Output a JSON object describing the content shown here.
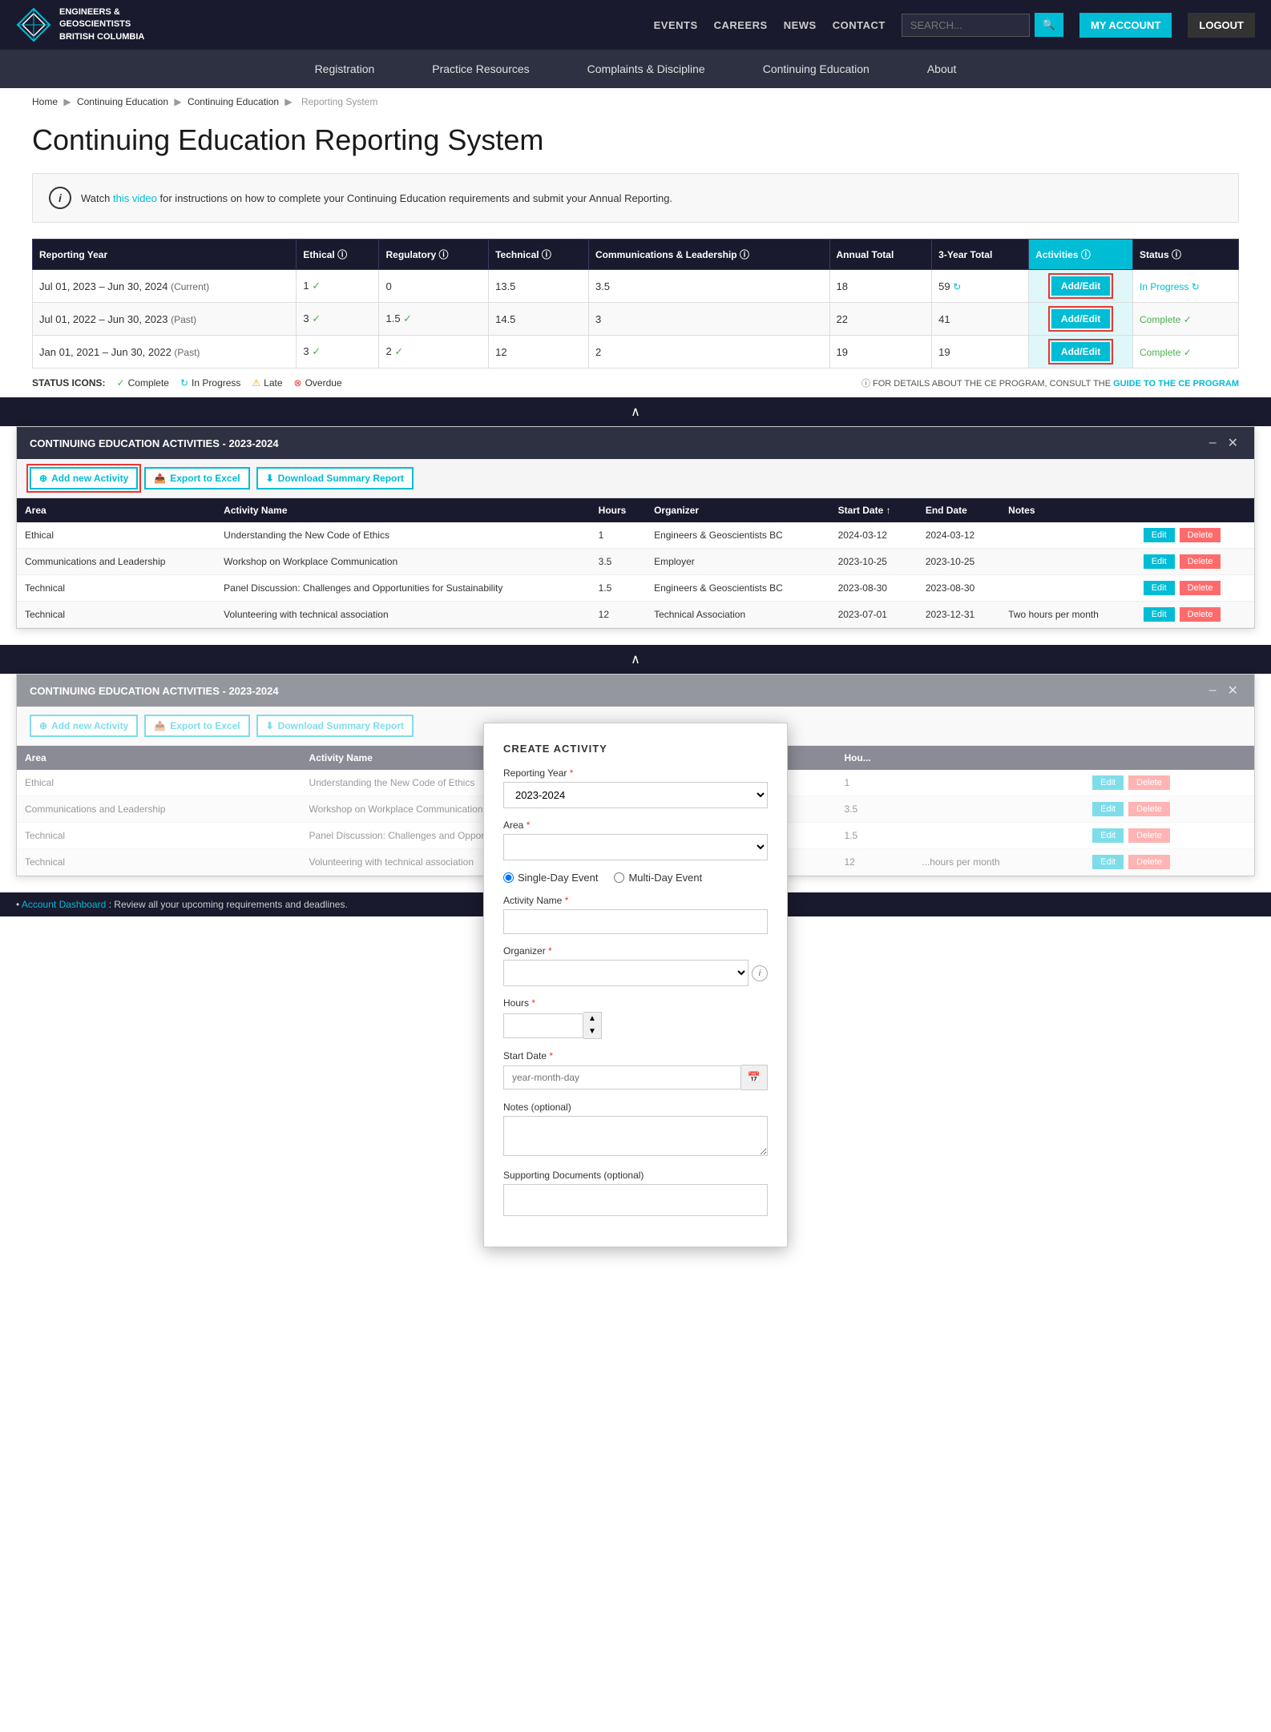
{
  "topNav": {
    "logoLine1": "ENGINEERS &",
    "logoLine2": "GEOSCIENTISTS",
    "logoLine3": "BRITISH COLUMBIA",
    "links": [
      "EVENTS",
      "CAREERS",
      "NEWS",
      "CONTACT"
    ],
    "searchPlaceholder": "SEARCH...",
    "myAccountLabel": "MY ACCOUNT",
    "logoutLabel": "LOGOUT"
  },
  "secNav": {
    "items": [
      "Registration",
      "Practice Resources",
      "Complaints & Discipline",
      "Continuing Education",
      "About"
    ]
  },
  "breadcrumb": {
    "items": [
      "Home",
      "Continuing Education",
      "Continuing Education",
      "Reporting System"
    ]
  },
  "pageTitle": "Continuing Education Reporting System",
  "infoBox": {
    "text1": "Watch ",
    "linkText": "this video",
    "text2": " for instructions on how to complete your Continuing Education requirements and submit your Annual Reporting."
  },
  "reportTable": {
    "headers": [
      "Reporting Year",
      "Ethical ⓘ",
      "Regulatory ⓘ",
      "Technical ⓘ",
      "Communications & Leadership ⓘ",
      "Annual Total",
      "3-Year Total",
      "Activities ⓘ",
      "Status ⓘ"
    ],
    "rows": [
      {
        "year": "Jul 01, 2023 – Jun 30, 2024",
        "yearTag": "(Current)",
        "ethical": "1",
        "regulatory": "0",
        "technical": "13.5",
        "comms": "3.5",
        "annualTotal": "18",
        "threeYearTotal": "59",
        "status": "In Progress",
        "statusType": "inprogress"
      },
      {
        "year": "Jul 01, 2022 – Jun 30, 2023",
        "yearTag": "(Past)",
        "ethical": "3",
        "regulatory": "1.5",
        "technical": "14.5",
        "comms": "3",
        "annualTotal": "22",
        "threeYearTotal": "41",
        "status": "Complete",
        "statusType": "complete"
      },
      {
        "year": "Jan 01, 2021 – Jun 30, 2022",
        "yearTag": "(Past)",
        "ethical": "3",
        "regulatory": "2",
        "technical": "12",
        "comms": "2",
        "annualTotal": "19",
        "threeYearTotal": "19",
        "status": "Complete",
        "statusType": "complete"
      }
    ],
    "addEditLabel": "Add/Edit"
  },
  "statusLegend": {
    "items": [
      {
        "icon": "✓",
        "color": "#4caf50",
        "label": "Complete"
      },
      {
        "icon": "↻",
        "color": "#00bcd4",
        "label": "In Progress"
      },
      {
        "icon": "⚠",
        "color": "#ff9800",
        "label": "Late"
      },
      {
        "icon": "⊗",
        "color": "#e53935",
        "label": "Overdue"
      }
    ],
    "rightText": "FOR DETAILS ABOUT THE CE PROGRAM, CONSULT THE ",
    "rightLink": "GUIDE TO THE CE PROGRAM"
  },
  "panel1": {
    "title": "CONTINUING EDUCATION ACTIVITIES - 2023-2024",
    "addNewLabel": "Add new Activity",
    "exportLabel": "Export to Excel",
    "downloadLabel": "Download Summary Report",
    "tableHeaders": [
      "Area",
      "Activity Name",
      "Hours",
      "Organizer",
      "Start Date ↑",
      "End Date",
      "Notes"
    ],
    "rows": [
      {
        "area": "Ethical",
        "name": "Understanding the New Code of Ethics",
        "hours": "1",
        "organizer": "Engineers & Geoscientists BC",
        "startDate": "2024-03-12",
        "endDate": "2024-03-12",
        "notes": ""
      },
      {
        "area": "Communications and Leadership",
        "name": "Workshop on Workplace Communication",
        "hours": "3.5",
        "organizer": "Employer",
        "startDate": "2023-10-25",
        "endDate": "2023-10-25",
        "notes": ""
      },
      {
        "area": "Technical",
        "name": "Panel Discussion: Challenges and Opportunities for Sustainability",
        "hours": "1.5",
        "organizer": "Engineers & Geoscientists BC",
        "startDate": "2023-08-30",
        "endDate": "2023-08-30",
        "notes": ""
      },
      {
        "area": "Technical",
        "name": "Volunteering with technical association",
        "hours": "12",
        "organizer": "Technical Association",
        "startDate": "2023-07-01",
        "endDate": "2023-12-31",
        "notes": "Two hours per month"
      }
    ],
    "editLabel": "Edit",
    "deleteLabel": "Delete"
  },
  "panel2": {
    "title": "CONTINUING EDUCATION ACTIVITIES - 2023-2024",
    "addNewLabel": "Add new Activity",
    "exportLabel": "Export to Excel",
    "downloadLabel": "Download Summary Report"
  },
  "createModal": {
    "title": "CREATE ACTIVITY",
    "reportingYearLabel": "Reporting Year",
    "reportingYearValue": "2023-2024",
    "areaLabel": "Area",
    "areaPlaceholder": "",
    "singleDayLabel": "Single-Day Event",
    "multiDayLabel": "Multi-Day Event",
    "activityNameLabel": "Activity Name",
    "organizerLabel": "Organizer",
    "hoursLabel": "Hours",
    "startDateLabel": "Start Date",
    "startDatePlaceholder": "year-month-day",
    "notesLabel": "Notes (optional)",
    "supportingDocsLabel": "Supporting Documents (optional)"
  },
  "bottomBar": {
    "bullet": "•",
    "linkText": "Account Dashboard",
    "text": ": Review all your upcoming requirements and deadlines."
  }
}
